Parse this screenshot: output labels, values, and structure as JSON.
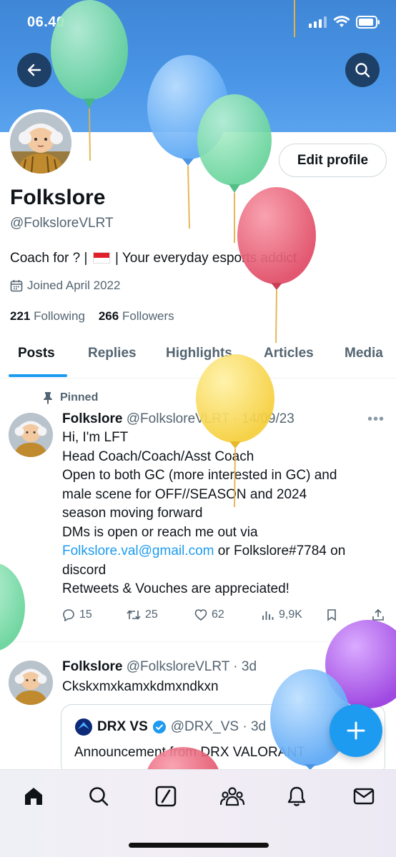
{
  "status_bar": {
    "time": "06.40"
  },
  "profile": {
    "name": "Folkslore",
    "handle": "@FolksloreVLRT",
    "bio_before_flag": "Coach for ? | ",
    "bio_after_flag": " | Your everyday esports addict",
    "joined": "Joined April 2022",
    "following_count": "221",
    "following_label": "Following",
    "followers_count": "266",
    "followers_label": "Followers",
    "edit_profile_label": "Edit profile"
  },
  "tabs": [
    {
      "label": "Posts",
      "active": true
    },
    {
      "label": "Replies",
      "active": false
    },
    {
      "label": "Highlights",
      "active": false
    },
    {
      "label": "Articles",
      "active": false
    },
    {
      "label": "Media",
      "active": false
    }
  ],
  "pinned_tweet": {
    "pinned_label": "Pinned",
    "name": "Folkslore",
    "meta": "@FolksloreVLRT · 14/09/23",
    "lines": [
      "Hi, I'm LFT",
      "Head Coach/Coach/Asst Coach",
      "Open to both GC (more interested in GC) and",
      "male scene for OFF//SEASON and 2024",
      "season moving forward",
      "DMs is open or reach me out via"
    ],
    "link": "Folkslore.val@gmail.com",
    "after_link": " or Folkslore#7784 on",
    "lines_after": [
      "discord",
      "Retweets & Vouches are appreciated!"
    ],
    "replies": "15",
    "retweets": "25",
    "likes": "62",
    "views": "9,9K"
  },
  "second_tweet": {
    "name": "Folkslore",
    "meta": "@FolksloreVLRT · 3d",
    "text": "Ckskxmxkamxkdmxndkxn",
    "quote": {
      "name": "DRX VS",
      "meta": "@DRX_VS · 3d",
      "text": "Announcement from DRX VALORANT"
    }
  },
  "icons": {
    "back": "back-arrow-icon",
    "search": "search-icon",
    "calendar": "calendar-icon",
    "pin": "pin-icon",
    "compose": "plus-icon"
  },
  "colors": {
    "accent": "#1d9bf0",
    "banner": "#4a95e6",
    "muted_text": "#536471"
  }
}
